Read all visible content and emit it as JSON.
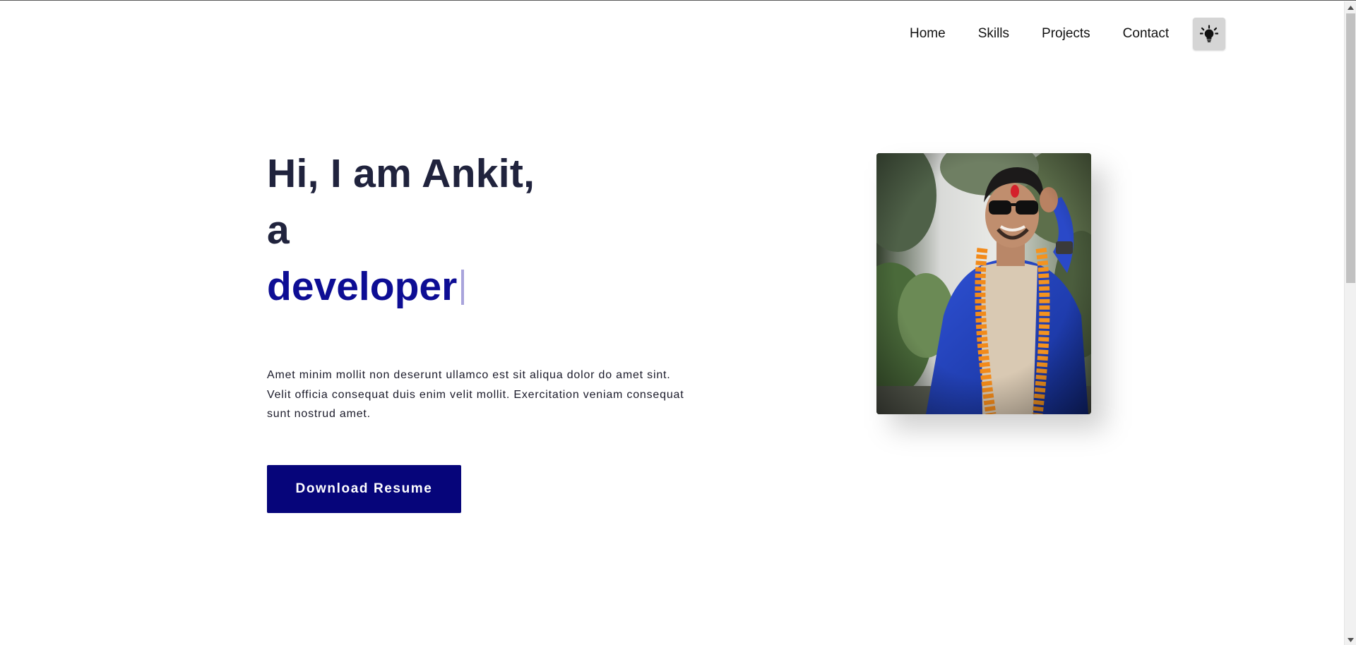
{
  "nav": {
    "links": [
      "Home",
      "Skills",
      "Projects",
      "Contact"
    ],
    "theme_toggle_icon": "lightbulb-icon"
  },
  "hero": {
    "greeting": "Hi, I am Ankit,",
    "article": "a",
    "role": "developer",
    "bio": "Amet minim mollit non deserunt ullamco est sit aliqua dolor do amet sint. Velit officia consequat duis enim velit mollit. Exercitation veniam consequat sunt nostrud amet.",
    "cta_label": "Download Resume"
  },
  "colors": {
    "heading": "#20233d",
    "accent": "#0d0d94",
    "button_bg": "#06057a",
    "caret": "#a9a4dc",
    "toggle_bg": "#d5d5d5"
  }
}
